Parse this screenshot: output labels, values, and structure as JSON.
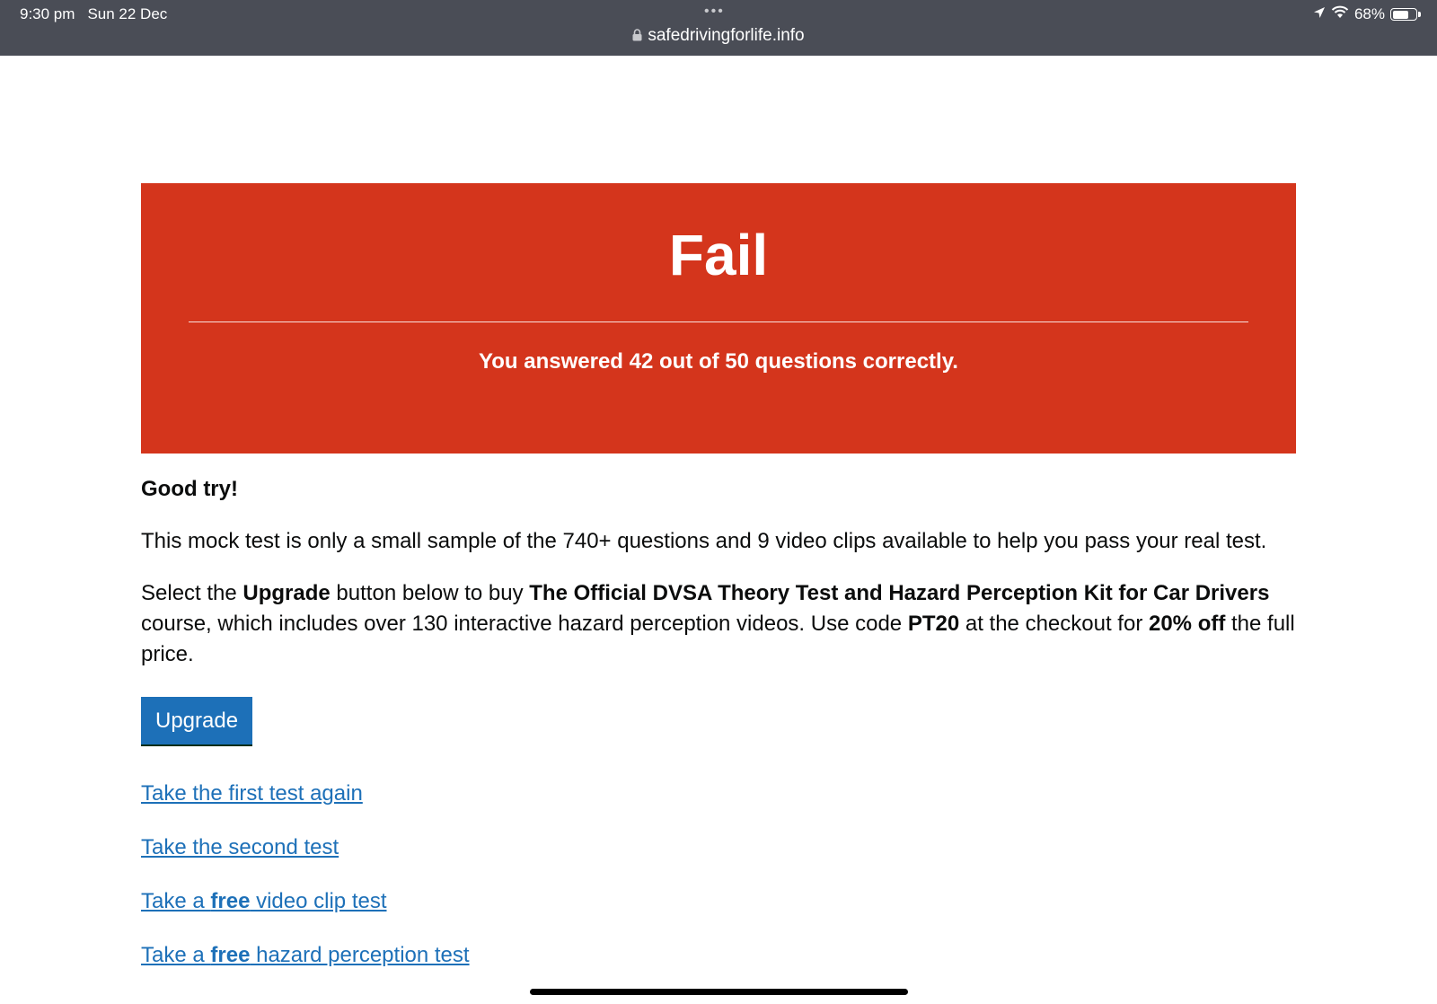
{
  "status_bar": {
    "time": "9:30 pm",
    "date": "Sun 22 Dec",
    "url": "safedrivingforlife.info",
    "battery": "68%",
    "battery_level": 0.68
  },
  "result": {
    "title": "Fail",
    "score_text": "You answered 42 out of 50 questions correctly.",
    "color": "#d4351c"
  },
  "content": {
    "lead": "Good try!",
    "para1": "This mock test is only a small sample of the 740+ questions and 9 video clips available to help you pass your real test.",
    "para2": {
      "t1": "Select the ",
      "b1": "Upgrade",
      "t2": " button below to buy ",
      "b2": "The Official DVSA Theory Test and Hazard Perception Kit for Car Drivers",
      "t3": " course, which includes over 130 interactive hazard perception videos. Use code ",
      "b3": "PT20",
      "t4": " at the checkout for ",
      "b4": "20% off",
      "t5": " the full price."
    },
    "upgrade_label": "Upgrade"
  },
  "links": [
    {
      "label": "Take the first test again"
    },
    {
      "label": "Take the second test"
    },
    {
      "pre": "Take a ",
      "bold": "free",
      "post": " video clip test"
    },
    {
      "pre": "Take a ",
      "bold": "free",
      "post": " hazard perception test"
    }
  ]
}
